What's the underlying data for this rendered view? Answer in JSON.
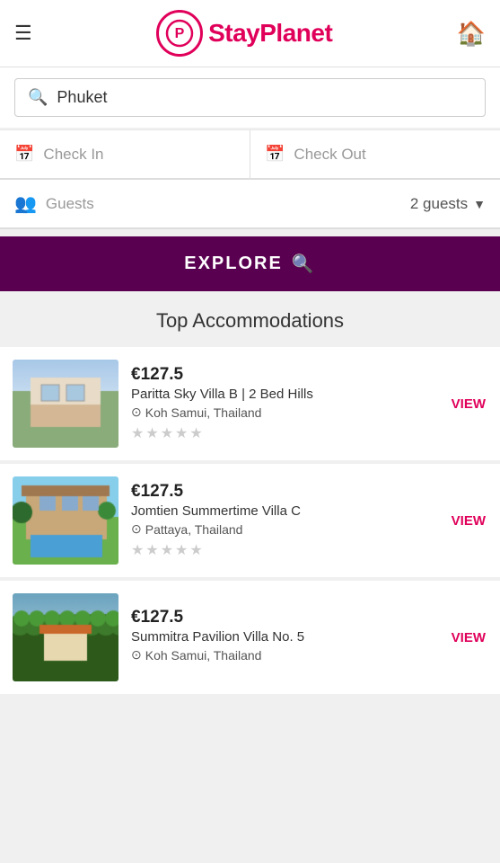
{
  "header": {
    "logo_text": "StayPlanet",
    "home_icon": "🏠"
  },
  "search": {
    "placeholder": "Phuket",
    "value": "Phuket"
  },
  "checkin": {
    "label": "Check In"
  },
  "checkout": {
    "label": "Check Out"
  },
  "guests": {
    "label": "Guests",
    "value": "2 guests"
  },
  "explore_button": {
    "label": "EXPLORE"
  },
  "accommodations": {
    "section_title": "Top Accommodations",
    "properties": [
      {
        "price": "€127.5",
        "name": "Paritta Sky Villa B | 2 Bed Hills",
        "location": "Koh Samui, Thailand",
        "view_label": "VIEW",
        "stars": [
          0,
          0,
          0,
          0,
          0
        ],
        "img_colors": [
          "#8aab7a",
          "#d4c8a8",
          "#b0c4b8"
        ]
      },
      {
        "price": "€127.5",
        "name": "Jomtien Summertime Villa C",
        "location": "Pattaya, Thailand",
        "view_label": "VIEW",
        "stars": [
          0,
          0,
          0,
          0,
          0
        ],
        "img_colors": [
          "#c4a870",
          "#7aa890",
          "#5090b0"
        ]
      },
      {
        "price": "€127.5",
        "name": "Summitra Pavilion Villa No. 5",
        "location": "Koh Samui, Thailand",
        "view_label": "VIEW",
        "stars": [
          0,
          0,
          0,
          0,
          0
        ],
        "img_colors": [
          "#4a7a50",
          "#6ab080",
          "#a8c870"
        ]
      }
    ]
  }
}
